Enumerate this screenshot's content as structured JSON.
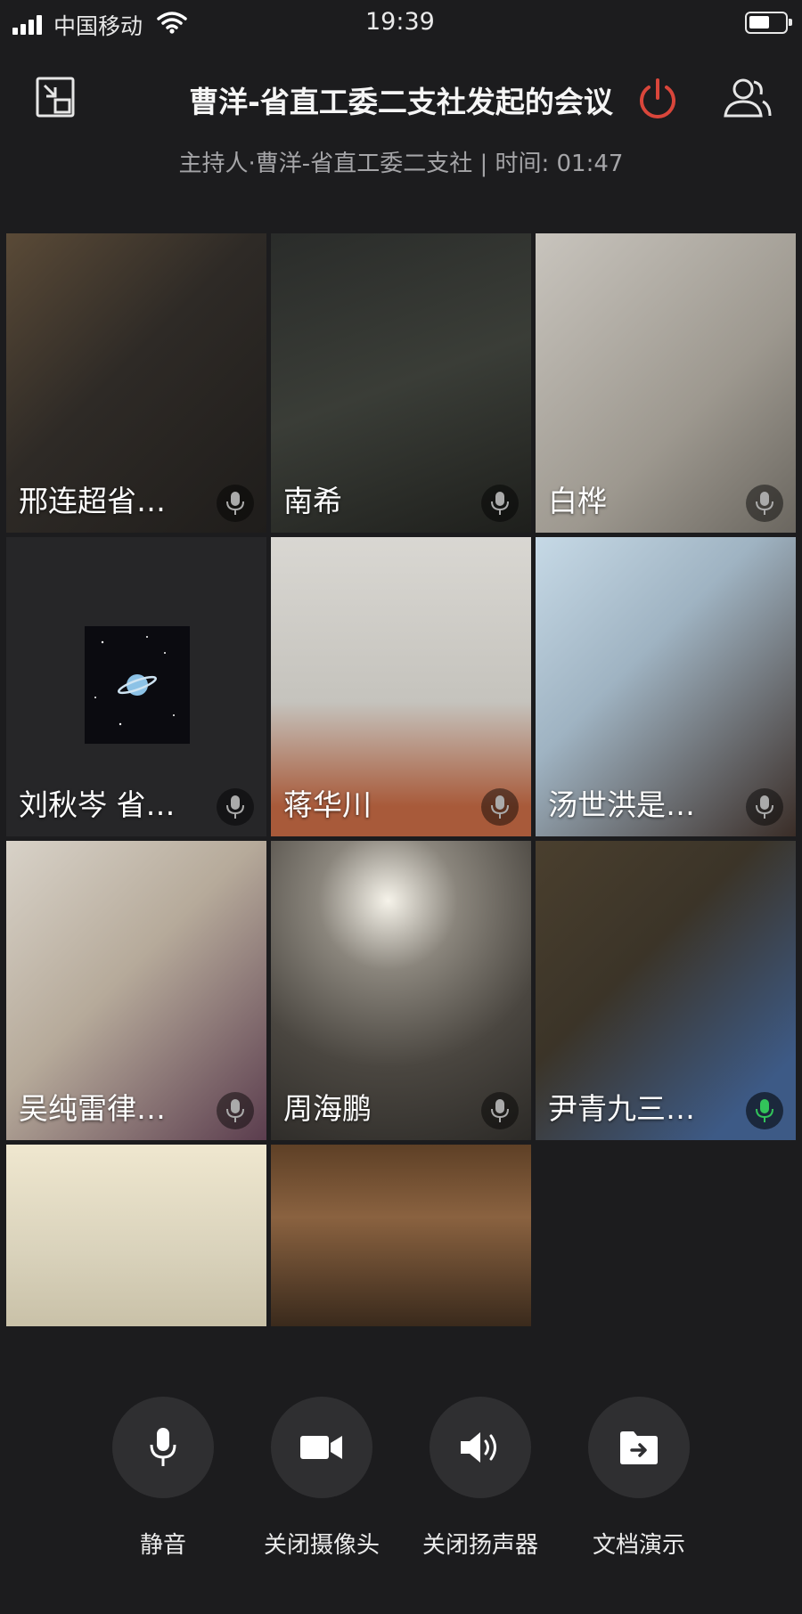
{
  "status_bar": {
    "carrier": "中国移动",
    "time": "19:39"
  },
  "header": {
    "title": "曹洋-省直工委二支社发起的会议",
    "subtitle": "主持人·曹洋-省直工委二支社 | 时间: 01:47"
  },
  "participants": [
    {
      "name": "邢连超省…",
      "speaking": false
    },
    {
      "name": "南希",
      "speaking": false
    },
    {
      "name": "白桦",
      "speaking": false
    },
    {
      "name": "刘秋岑 省…",
      "speaking": false
    },
    {
      "name": "蒋华川",
      "speaking": false
    },
    {
      "name": "汤世洪是…",
      "speaking": false
    },
    {
      "name": "吴纯雷律…",
      "speaking": false
    },
    {
      "name": "周海鹏",
      "speaking": false
    },
    {
      "name": "尹青九三…",
      "speaking": true
    },
    {
      "name": "",
      "speaking": false
    },
    {
      "name": "",
      "speaking": false
    }
  ],
  "controls": [
    {
      "label": "静音",
      "icon": "microphone-icon"
    },
    {
      "label": "关闭摄像头",
      "icon": "camera-icon"
    },
    {
      "label": "关闭扬声器",
      "icon": "speaker-icon"
    },
    {
      "label": "文档演示",
      "icon": "document-share-icon"
    }
  ],
  "colors": {
    "background": "#1c1c1e",
    "power": "#d9463b",
    "mic_active": "#32c45a"
  }
}
